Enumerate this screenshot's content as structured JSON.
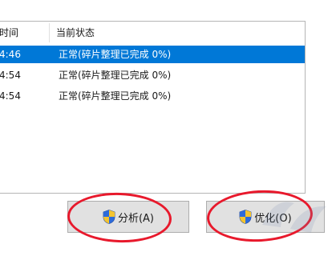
{
  "list": {
    "columns": [
      "时间",
      "当前状态"
    ],
    "rows": [
      {
        "time": "4:46",
        "status": "正常(碎片整理已完成 0%)",
        "selected": true
      },
      {
        "time": "4:54",
        "status": "正常(碎片整理已完成 0%)",
        "selected": false
      },
      {
        "time": "4:54",
        "status": "正常(碎片整理已完成 0%)",
        "selected": false
      }
    ]
  },
  "buttons": {
    "analyze_label": "分析(A)",
    "optimize_label": "优化(O)"
  },
  "colors": {
    "selection": "#0078d7",
    "annotation_circle": "#e8192c",
    "button_face": "#e1e1e1"
  },
  "icons": {
    "button_icon": "uac-shield-icon"
  }
}
